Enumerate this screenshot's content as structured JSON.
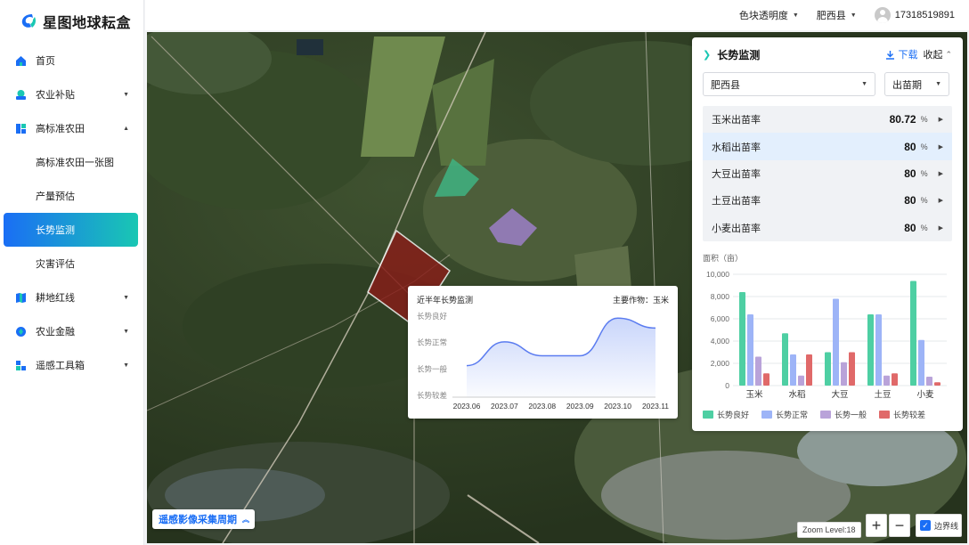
{
  "app": {
    "title": "星图地球耘盒"
  },
  "sidebar": {
    "items": [
      {
        "label": "首页"
      },
      {
        "label": "农业补贴"
      },
      {
        "label": "高标准农田"
      },
      {
        "label": "高标准农田一张图"
      },
      {
        "label": "产量预估"
      },
      {
        "label": "长势监测"
      },
      {
        "label": "灾害评估"
      },
      {
        "label": "耕地红线"
      },
      {
        "label": "农业金融"
      },
      {
        "label": "遥感工具箱"
      }
    ]
  },
  "topbar": {
    "opacity_label": "色块透明度",
    "region_label": "肥西县",
    "user_phone": "17318519891"
  },
  "panel": {
    "title": "长势监测",
    "download_label": "下载",
    "collapse_label": "收起",
    "county_select": "肥西县",
    "period_select": "出苗期",
    "rates": [
      {
        "label": "玉米出苗率",
        "value": "80.72",
        "unit": "%"
      },
      {
        "label": "水稻出苗率",
        "value": "80",
        "unit": "%"
      },
      {
        "label": "大豆出苗率",
        "value": "80",
        "unit": "%"
      },
      {
        "label": "土豆出苗率",
        "value": "80",
        "unit": "%"
      },
      {
        "label": "小麦出苗率",
        "value": "80",
        "unit": "%"
      }
    ],
    "chart_ylabel": "面积（亩）"
  },
  "popup": {
    "title": "近半年长势监测",
    "crop_label": "主要作物：玉米"
  },
  "map": {
    "cycle_button": "遥感影像采集周期",
    "zoom_level": "Zoom Level:18",
    "zoom_in": "+",
    "zoom_out": "−",
    "boundary_label": "边界线"
  },
  "colors": {
    "accent": "#1a6ef5",
    "accent2": "#19c7b3",
    "good": "#4ecfa3",
    "normal": "#9db4f7",
    "average": "#b9a3d9",
    "poor": "#e06969"
  },
  "chart_data": [
    {
      "type": "bar",
      "title": "",
      "ylabel": "面积（亩）",
      "categories": [
        "玉米",
        "水稻",
        "大豆",
        "土豆",
        "小麦"
      ],
      "ylim": [
        0,
        10000
      ],
      "yticks": [
        "10,000",
        "8,000",
        "6,000",
        "4,000",
        "2,000",
        "0"
      ],
      "series": [
        {
          "name": "长势良好",
          "color": "#4ecfa3",
          "values": [
            8400,
            4700,
            3000,
            6400,
            9400
          ]
        },
        {
          "name": "长势正常",
          "color": "#9db4f7",
          "values": [
            6400,
            2800,
            7800,
            6400,
            4100
          ]
        },
        {
          "name": "长势一般",
          "color": "#b9a3d9",
          "values": [
            2600,
            900,
            2100,
            900,
            800
          ]
        },
        {
          "name": "长势较差",
          "color": "#e06969",
          "values": [
            1100,
            2800,
            3000,
            1100,
            300
          ]
        }
      ],
      "legend": "bottom"
    },
    {
      "type": "line",
      "title": "近半年长势监测",
      "x": [
        "2023.06",
        "2023.07",
        "2023.08",
        "2023.09",
        "2023.10",
        "2023.11"
      ],
      "ycategories": [
        "长势良好",
        "长势正常",
        "长势一般",
        "长势较差"
      ],
      "y": [
        2.5,
        3.7,
        3.0,
        3.0,
        4.9,
        4.4
      ]
    }
  ]
}
